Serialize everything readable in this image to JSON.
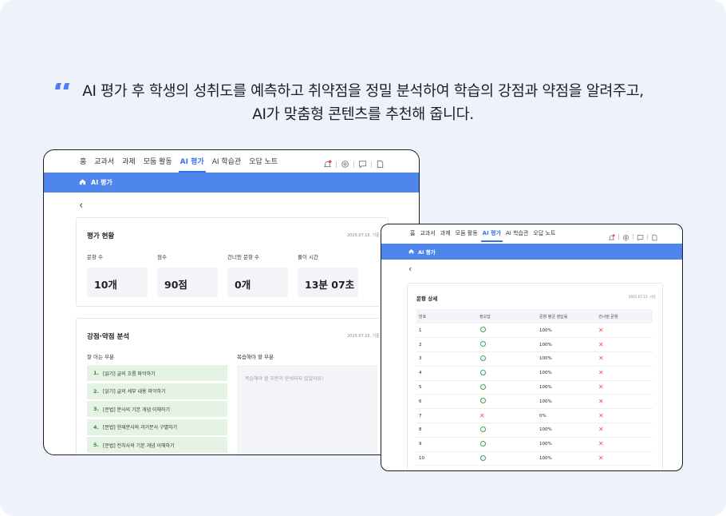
{
  "headline": {
    "line1": "AI 평가 후 학생의 성취도를 예측하고 취약점을 정밀 분석하여 학습의 강점과 약점을 알려주고,",
    "line2": "AI가 맞춤형 콘텐츠를 추천해 줍니다."
  },
  "nav": {
    "items": [
      "홈",
      "교과서",
      "과제",
      "모둠 활동",
      "AI 평가",
      "AI 학습관",
      "오답 노트"
    ],
    "active_index": 4,
    "icons": [
      "bell-icon",
      "settings-icon",
      "chat-icon",
      "document-icon"
    ]
  },
  "bar": {
    "title": "AI 평가"
  },
  "status_card": {
    "title": "평가 현황",
    "date": "2025.07.15. 기준",
    "stats": [
      {
        "label": "문항 수",
        "value": "10개"
      },
      {
        "label": "점수",
        "value": "90점"
      },
      {
        "label": "건너뛴 문항 수",
        "value": "0개"
      },
      {
        "label": "풀이 시간",
        "value": "13분 07초"
      }
    ]
  },
  "analysis_card": {
    "title": "강점·약점 분석",
    "date": "2025.07.15. 기준",
    "strong_label": "잘 아는 부분",
    "weak_label": "복습해야 할 부분",
    "strong_items": [
      {
        "no": "1.",
        "text": "[읽기] 글의 흐름 파악하기"
      },
      {
        "no": "2.",
        "text": "[읽기] 글의 세부 내용 파악하기"
      },
      {
        "no": "3.",
        "text": "[문법] 분사의 기본 개념 이해하기"
      },
      {
        "no": "4.",
        "text": "[문법] 현재분사와 과거분사 구별하기"
      },
      {
        "no": "5.",
        "text": "[문법] 전치사의 기본 개념 이해하기"
      }
    ],
    "weak_message": "복습해야 할 부분이 분석되지 않았어요!"
  },
  "detail_card": {
    "title": "문항 상세",
    "date": "2025.07.15. 기준",
    "columns": [
      "번호",
      "정오답",
      "문항 평균 정답률",
      "건너뛴 문항"
    ],
    "rows": [
      {
        "no": "1",
        "correct": true,
        "rate": "100%",
        "skipped": false
      },
      {
        "no": "2",
        "correct": true,
        "rate": "100%",
        "skipped": false
      },
      {
        "no": "3",
        "correct": true,
        "rate": "100%",
        "skipped": false
      },
      {
        "no": "4",
        "correct": true,
        "rate": "100%",
        "skipped": false
      },
      {
        "no": "5",
        "correct": true,
        "rate": "100%",
        "skipped": false
      },
      {
        "no": "6",
        "correct": true,
        "rate": "100%",
        "skipped": false
      },
      {
        "no": "7",
        "correct": false,
        "rate": "0%",
        "skipped": false
      },
      {
        "no": "8",
        "correct": true,
        "rate": "100%",
        "skipped": false
      },
      {
        "no": "9",
        "correct": true,
        "rate": "100%",
        "skipped": false
      },
      {
        "no": "10",
        "correct": true,
        "rate": "100%",
        "skipped": false
      }
    ]
  },
  "colors": {
    "accent": "#3d6fe6",
    "bar": "#4f86ee",
    "correct": "#35a852",
    "wrong": "#e8514f",
    "strong_row": "#e4f3e4"
  }
}
